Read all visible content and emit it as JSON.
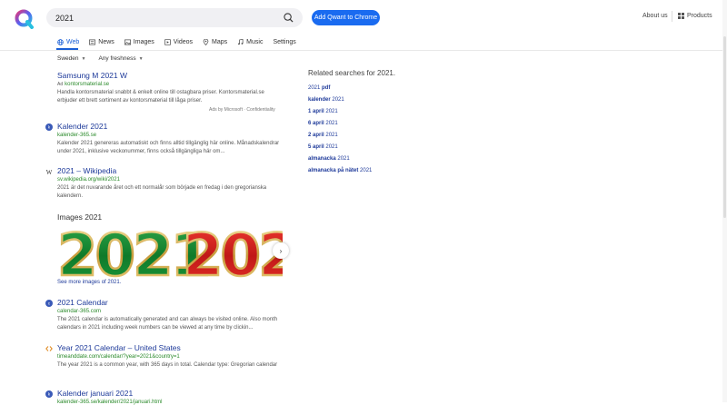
{
  "search": {
    "query": "2021"
  },
  "header": {
    "add_chrome": "Add Qwant to Chrome",
    "about": "About us",
    "products": "Products"
  },
  "tabs": [
    {
      "label": "Web",
      "icon": "globe-icon"
    },
    {
      "label": "News",
      "icon": "newspaper-icon"
    },
    {
      "label": "Images",
      "icon": "image-icon"
    },
    {
      "label": "Videos",
      "icon": "video-icon"
    },
    {
      "label": "Maps",
      "icon": "map-pin-icon"
    },
    {
      "label": "Music",
      "icon": "music-icon"
    },
    {
      "label": "Settings",
      "icon": ""
    }
  ],
  "filters": {
    "region": "Sweden",
    "freshness": "Any freshness"
  },
  "ad": {
    "title": "Samsung M 2021 W",
    "badge": "Ad",
    "url": "kontorsmaterial.se",
    "desc": "Handla kontorsmaterial snabbt & enkelt online till ostagbara priser. Kontorsmaterial.se erbjuder ett brett sortiment av kontorsmaterial till låga priser.",
    "by": "Ads by Microsoft · Confidentiality"
  },
  "results": [
    {
      "title": "Kalender 2021",
      "url": "kalender-365.se",
      "desc": "Kalender 2021 genereras automatiskt och finns alltid tillgänglig här online. Månadskalendrar under 2021, inklusive veckonummer, finns också tillgängliga här om..."
    },
    {
      "title": "2021 – Wikipedia",
      "url": "sv.wikipedia.org/wiki/2021",
      "desc": "2021 är det nuvarande året och ett normalår som började en fredag i den gregorianska kalendern."
    },
    {
      "title": "2021 Calendar",
      "url": "calendar-365.com",
      "desc": "The 2021 calendar is automatically generated and can always be visited online. Also month calendars in 2021 including week numbers can be viewed at any time by clickin..."
    },
    {
      "title": "Year 2021 Calendar – United States",
      "url": "timeanddate.com/calendar/?year=2021&country=1",
      "desc": "The year 2021 is a common year, with 365 days in total. Calendar type: Gregorian calendar"
    },
    {
      "title": "Kalender januari 2021",
      "url": "kalender-365.se/kalender/2021/januari.html",
      "desc": ""
    }
  ],
  "images": {
    "title": "Images 2021",
    "see_more": "See more images of 2021.",
    "img1_text": "2021",
    "img2_text": "202"
  },
  "related": {
    "title": "Related searches for 2021.",
    "items": [
      {
        "bold": "",
        "plain": "2021 ",
        "suffix": "pdf"
      },
      {
        "bold": "kalender",
        "plain": " 2021",
        "suffix": ""
      },
      {
        "bold": "1 april",
        "plain": " 2021",
        "suffix": ""
      },
      {
        "bold": "6 april",
        "plain": " 2021",
        "suffix": ""
      },
      {
        "bold": "2 april",
        "plain": " 2021",
        "suffix": ""
      },
      {
        "bold": "5 april",
        "plain": " 2021",
        "suffix": ""
      },
      {
        "bold": "almanacka",
        "plain": " 2021",
        "suffix": ""
      },
      {
        "bold": "almanacka på nätet",
        "plain": " 2021",
        "suffix": ""
      }
    ]
  },
  "colors": {
    "accent": "#1a5fd6",
    "link": "#1e3a9a",
    "url": "#2a8a2a",
    "button": "#1a6bf0"
  }
}
